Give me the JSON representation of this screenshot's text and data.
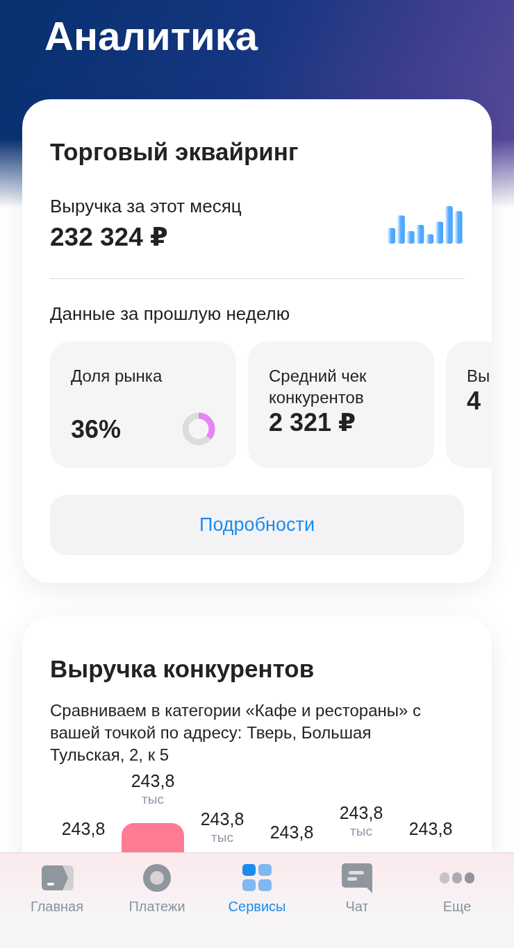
{
  "screen": {
    "title": "Аналитика"
  },
  "acquiring": {
    "title": "Торговый эквайринг",
    "revenue_label": "Выручка за этот месяц",
    "revenue_value": "232 324 ₽",
    "period_label": "Данные за прошлую неделю",
    "metrics": [
      {
        "kind": "donut",
        "label": "Доля рынка",
        "value": "36%",
        "level": 0.36
      },
      {
        "kind": "plain",
        "label": "Средний чек конкурентов",
        "value": "2 321 ₽"
      },
      {
        "kind": "plain",
        "label": "Вы",
        "value": "4"
      }
    ],
    "details_button": "Подробности"
  },
  "competitors": {
    "title": "Выручка конкурентов",
    "description": "Сравниваем в категории «Кафе и рестораны» с вашей точкой по адресу: Тверь, Большая Тульская, 2, к 5",
    "columns": [
      {
        "value": "243,8"
      },
      {
        "value": "243,8",
        "unit": "тыс"
      },
      {
        "value": "243,8",
        "unit": "тыс"
      },
      {
        "value": "243,8"
      },
      {
        "value": "243,8",
        "unit": "тыс"
      },
      {
        "value": "243,8"
      }
    ]
  },
  "tab_bar": [
    {
      "kind": "home",
      "label": "Главная",
      "selected": false
    },
    {
      "kind": "payments",
      "label": "Платежи",
      "selected": false
    },
    {
      "kind": "services",
      "label": "Сервисы",
      "selected": true
    },
    {
      "kind": "chat",
      "label": "Чат",
      "selected": false
    },
    {
      "kind": "more",
      "label": "Еще",
      "selected": false
    }
  ]
}
